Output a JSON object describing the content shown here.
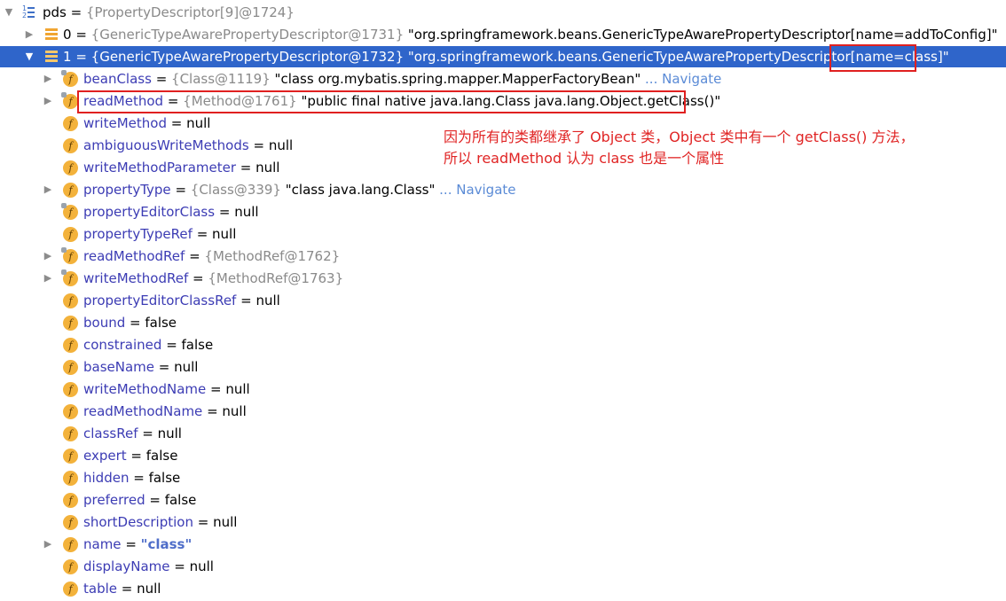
{
  "root": {
    "name": "pds",
    "value": "{PropertyDescriptor[9]@1724}"
  },
  "items": [
    {
      "name": "0",
      "ref": "{GenericTypeAwarePropertyDescriptor@1731}",
      "str": "\"org.springframework.beans.GenericTypeAwarePropertyDescriptor[name=addToConfig]\""
    },
    {
      "name": "1",
      "ref": "{GenericTypeAwarePropertyDescriptor@1732}",
      "str_a": "\"org.springframework.beans.GenericTypeAwarePropertyDescriptor",
      "str_b": "[name=class]",
      "str_c": "\""
    }
  ],
  "fields": [
    {
      "name": "beanClass",
      "ref": "{Class@1119}",
      "str": "\"class org.mybatis.spring.mapper.MapperFactoryBean\"",
      "nav": "... Navigate"
    },
    {
      "name": "readMethod",
      "ref": "{Method@1761}",
      "str": "\"public final native java.lang.Class java.lang.Object.getClass()\""
    },
    {
      "name": "writeMethod",
      "value": "null"
    },
    {
      "name": "ambiguousWriteMethods",
      "value": "null"
    },
    {
      "name": "writeMethodParameter",
      "value": "null"
    },
    {
      "name": "propertyType",
      "ref": "{Class@339}",
      "str": "\"class java.lang.Class\"",
      "nav": "... Navigate"
    },
    {
      "name": "propertyEditorClass",
      "value": "null"
    },
    {
      "name": "propertyTypeRef",
      "value": "null"
    },
    {
      "name": "readMethodRef",
      "ref": "{MethodRef@1762}"
    },
    {
      "name": "writeMethodRef",
      "ref": "{MethodRef@1763}"
    },
    {
      "name": "propertyEditorClassRef",
      "value": "null"
    },
    {
      "name": "bound",
      "value": "false"
    },
    {
      "name": "constrained",
      "value": "false"
    },
    {
      "name": "baseName",
      "value": "null"
    },
    {
      "name": "writeMethodName",
      "value": "null"
    },
    {
      "name": "readMethodName",
      "value": "null"
    },
    {
      "name": "classRef",
      "value": "null"
    },
    {
      "name": "expert",
      "value": "false"
    },
    {
      "name": "hidden",
      "value": "false"
    },
    {
      "name": "preferred",
      "value": "false"
    },
    {
      "name": "shortDescription",
      "value": "null"
    },
    {
      "name": "name",
      "str": "\"class\""
    },
    {
      "name": "displayName",
      "value": "null"
    },
    {
      "name": "table",
      "value": "null"
    }
  ],
  "eq": " = ",
  "annotation": {
    "line1": "因为所有的类都继承了 Object 类，Object 类中有一个 getClass() 方法，",
    "line2": "所以 readMethod 认为 class 也是一个属性"
  },
  "colors": {
    "selection": "#2f65ca",
    "annotation_red": "#e02020",
    "field_icon": "#f3b23b"
  }
}
